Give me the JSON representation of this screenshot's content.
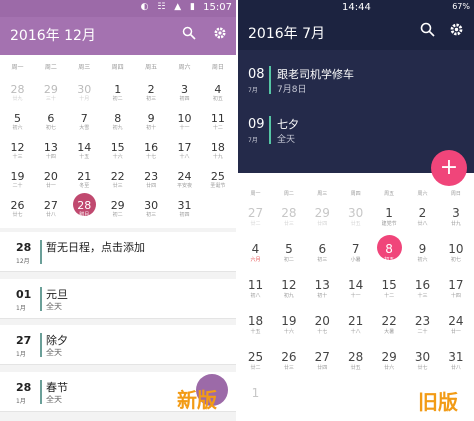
{
  "left": {
    "status": {
      "icons": "◐ ☷ ▲ ▮",
      "time": "15:07"
    },
    "title": "2016年 12月",
    "weekdays": [
      "周一",
      "周二",
      "周三",
      "周四",
      "周五",
      "周六",
      "周日"
    ],
    "weeks": [
      [
        {
          "n": "28",
          "s": "廿九",
          "dim": true
        },
        {
          "n": "29",
          "s": "三十",
          "dim": true
        },
        {
          "n": "30",
          "s": "十月",
          "dim": true
        },
        {
          "n": "1",
          "s": "初二"
        },
        {
          "n": "2",
          "s": "初三"
        },
        {
          "n": "3",
          "s": "初四"
        },
        {
          "n": "4",
          "s": "初五"
        }
      ],
      [
        {
          "n": "5",
          "s": "初六"
        },
        {
          "n": "6",
          "s": "初七"
        },
        {
          "n": "7",
          "s": "大雪"
        },
        {
          "n": "8",
          "s": "初九"
        },
        {
          "n": "9",
          "s": "初十"
        },
        {
          "n": "10",
          "s": "十一"
        },
        {
          "n": "11",
          "s": "十二"
        }
      ],
      [
        {
          "n": "12",
          "s": "十三"
        },
        {
          "n": "13",
          "s": "十四"
        },
        {
          "n": "14",
          "s": "十五"
        },
        {
          "n": "15",
          "s": "十六"
        },
        {
          "n": "16",
          "s": "十七"
        },
        {
          "n": "17",
          "s": "十八"
        },
        {
          "n": "18",
          "s": "十九"
        }
      ],
      [
        {
          "n": "19",
          "s": "二十"
        },
        {
          "n": "20",
          "s": "廿一"
        },
        {
          "n": "21",
          "s": "冬至"
        },
        {
          "n": "22",
          "s": "廿三"
        },
        {
          "n": "23",
          "s": "廿四"
        },
        {
          "n": "24",
          "s": "平安夜"
        },
        {
          "n": "25",
          "s": "圣诞节"
        }
      ],
      [
        {
          "n": "26",
          "s": "廿七"
        },
        {
          "n": "27",
          "s": "廿八"
        },
        {
          "n": "28",
          "s": "腊月",
          "sel": true
        },
        {
          "n": "29",
          "s": "初二"
        },
        {
          "n": "30",
          "s": "初三"
        },
        {
          "n": "31",
          "s": "初四"
        },
        {
          "n": "",
          "s": ""
        }
      ]
    ],
    "events": [
      {
        "d": "28",
        "m": "12月",
        "t": "暂无日程，点击添加",
        "s": ""
      },
      {
        "d": "01",
        "m": "1月",
        "t": "元旦",
        "s": "全天"
      },
      {
        "d": "27",
        "m": "1月",
        "t": "除夕",
        "s": "全天"
      },
      {
        "d": "28",
        "m": "1月",
        "t": "春节",
        "s": "全天"
      }
    ],
    "tag": "新版"
  },
  "right": {
    "status": {
      "time": "14:44",
      "battery": "67%"
    },
    "title": "2016年 7月",
    "events": [
      {
        "d": "08",
        "m": "7月",
        "t": "跟老司机学修车",
        "s": "7月8日"
      },
      {
        "d": "09",
        "m": "7月",
        "t": "七夕",
        "s": "全天"
      }
    ],
    "fab": "+",
    "weekdays": [
      "周一",
      "周二",
      "周三",
      "周四",
      "周五",
      "周六",
      "周日"
    ],
    "weeks": [
      [
        {
          "n": "27",
          "s": "廿二",
          "dim": true
        },
        {
          "n": "28",
          "s": "廿三",
          "dim": true
        },
        {
          "n": "29",
          "s": "廿四",
          "dim": true
        },
        {
          "n": "30",
          "s": "廿五",
          "dim": true
        },
        {
          "n": "1",
          "s": "建党节"
        },
        {
          "n": "2",
          "s": "廿八"
        },
        {
          "n": "3",
          "s": "廿九"
        }
      ],
      [
        {
          "n": "4",
          "s": "六月",
          "red": true
        },
        {
          "n": "5",
          "s": "初二"
        },
        {
          "n": "6",
          "s": "初三"
        },
        {
          "n": "7",
          "s": "小暑"
        },
        {
          "n": "8",
          "s": "初五",
          "sel": true
        },
        {
          "n": "9",
          "s": "初六"
        },
        {
          "n": "10",
          "s": "初七"
        }
      ],
      [
        {
          "n": "11",
          "s": "初八"
        },
        {
          "n": "12",
          "s": "初九"
        },
        {
          "n": "13",
          "s": "初十"
        },
        {
          "n": "14",
          "s": "十一"
        },
        {
          "n": "15",
          "s": "十二"
        },
        {
          "n": "16",
          "s": "十三"
        },
        {
          "n": "17",
          "s": "十四"
        }
      ],
      [
        {
          "n": "18",
          "s": "十五"
        },
        {
          "n": "19",
          "s": "十六"
        },
        {
          "n": "20",
          "s": "十七"
        },
        {
          "n": "21",
          "s": "十八"
        },
        {
          "n": "22",
          "s": "大暑"
        },
        {
          "n": "23",
          "s": "二十"
        },
        {
          "n": "24",
          "s": "廿一"
        }
      ],
      [
        {
          "n": "25",
          "s": "廿二"
        },
        {
          "n": "26",
          "s": "廿三"
        },
        {
          "n": "27",
          "s": "廿四"
        },
        {
          "n": "28",
          "s": "廿五"
        },
        {
          "n": "29",
          "s": "廿六"
        },
        {
          "n": "30",
          "s": "廿七"
        },
        {
          "n": "31",
          "s": "廿八"
        }
      ],
      [
        {
          "n": "1",
          "s": "",
          "dim": true
        },
        {
          "n": "",
          "s": ""
        },
        {
          "n": "",
          "s": ""
        },
        {
          "n": "",
          "s": ""
        },
        {
          "n": "",
          "s": ""
        },
        {
          "n": "",
          "s": ""
        },
        {
          "n": "",
          "s": ""
        }
      ]
    ],
    "tag": "旧版"
  },
  "icons": {
    "search": "search-icon",
    "settings": "gear-icon",
    "add": "plus-icon"
  },
  "colors": {
    "left_bar": "#a472b0",
    "left_accent": "#c0496f",
    "right_bar": "#1c2340",
    "right_accent": "#f0457a",
    "tag": "#f29b15"
  }
}
